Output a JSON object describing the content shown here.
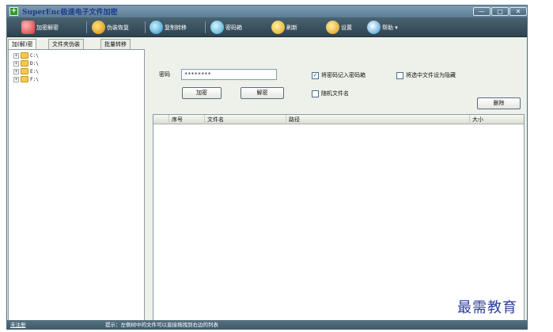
{
  "window": {
    "title": "SuperEnc极速电子文件加密"
  },
  "window_controls": {
    "minimize": "—",
    "maximize": "□",
    "close": "✕"
  },
  "toolbar": {
    "items": [
      {
        "label": "加密解密",
        "icon": "lock-icon"
      },
      {
        "label": "伪装恢复",
        "icon": "gear-icon"
      },
      {
        "label": "复制转移",
        "icon": "disk-icon"
      },
      {
        "label": "密码箱",
        "icon": "safe-icon"
      },
      {
        "label": "刷新",
        "icon": "refresh-icon"
      },
      {
        "label": "设置",
        "icon": "settings-icon"
      },
      {
        "label": "帮助 ▾",
        "icon": "help-icon"
      }
    ]
  },
  "tabs": [
    {
      "label": "加(解)密",
      "active": true
    },
    {
      "label": "文件夹伪装",
      "active": false
    },
    {
      "label": "批量转移",
      "active": false
    }
  ],
  "tree": {
    "drives": [
      "C:\\",
      "D:\\",
      "E:\\",
      "F:\\"
    ]
  },
  "form": {
    "password_label": "密码",
    "password_value": "********",
    "encrypt_button": "加密",
    "decrypt_button": "解密",
    "save_to_safe_label": "将密码记入密码箱",
    "save_to_safe_checked": true,
    "hide_selected_label": "将选中文件设为隐藏",
    "hide_selected_checked": false,
    "random_name_label": "随机文件名",
    "random_name_checked": false,
    "delete_button": "删除"
  },
  "file_list": {
    "columns": [
      "序号",
      "文件名",
      "路径",
      "大小"
    ],
    "rows": []
  },
  "statusbar": {
    "left": "未注册",
    "hint": "提示：左侧树中的文件可以直接拖拽到右边的列表"
  },
  "watermark": "最需教育"
}
